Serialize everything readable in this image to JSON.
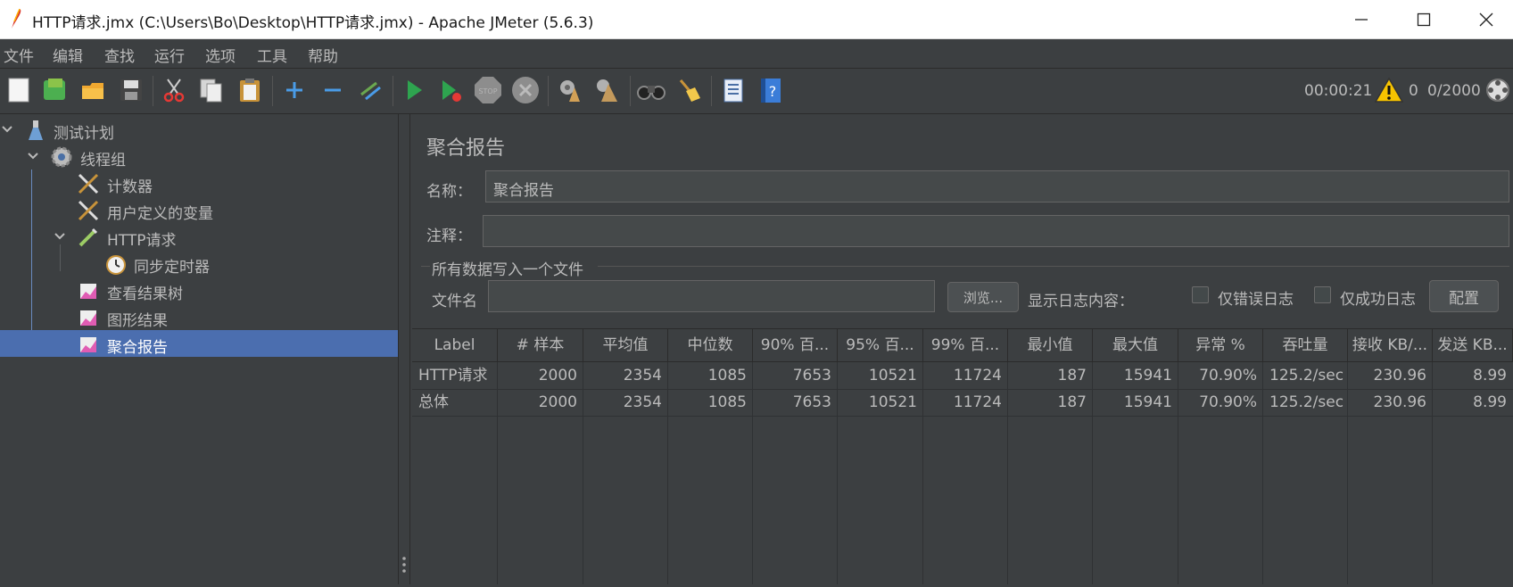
{
  "window": {
    "title": "HTTP请求.jmx (C:\\Users\\Bo\\Desktop\\HTTP请求.jmx) - Apache JMeter (5.6.3)"
  },
  "menu": [
    "文件",
    "编辑",
    "查找",
    "运行",
    "选项",
    "工具",
    "帮助"
  ],
  "toolbar": {
    "icons": [
      "new-icon",
      "templates-icon",
      "open-icon",
      "save-icon",
      "cut-icon",
      "copy-icon",
      "paste-icon",
      "expand-icon",
      "collapse-icon",
      "toggle-icon",
      "start-icon",
      "start-no-pause-icon",
      "stop-icon",
      "shutdown-icon",
      "clear-icon",
      "clear-all-icon",
      "search-icon",
      "reset-search-icon",
      "function-helper-icon",
      "help-icon"
    ],
    "elapsed": "00:00:21",
    "warning_count": "0",
    "threads": "0/2000"
  },
  "tree": {
    "items": [
      {
        "label": "测试计划",
        "icon": "test-plan-icon"
      },
      {
        "label": "线程组",
        "icon": "thread-group-icon"
      },
      {
        "label": "计数器",
        "icon": "config-tools-icon"
      },
      {
        "label": "用户定义的变量",
        "icon": "config-tools-icon"
      },
      {
        "label": "HTTP请求",
        "icon": "sampler-icon"
      },
      {
        "label": "同步定时器",
        "icon": "timer-icon"
      },
      {
        "label": "查看结果树",
        "icon": "listener-icon"
      },
      {
        "label": "图形结果",
        "icon": "listener-icon"
      },
      {
        "label": "聚合报告",
        "icon": "listener-icon"
      }
    ],
    "selected": "聚合报告"
  },
  "panel": {
    "title": "聚合报告",
    "name_label": "名称：",
    "name_value": "聚合报告",
    "comment_label": "注释：",
    "comment_value": "",
    "group_title": "所有数据写入一个文件",
    "file_label": "文件名",
    "file_value": "",
    "browse_label": "浏览...",
    "log_label": "显示日志内容：",
    "errors_only_label": "仅错误日志",
    "success_only_label": "仅成功日志",
    "configure_label": "配置"
  },
  "table": {
    "headers": [
      "Label",
      "# 样本",
      "平均值",
      "中位数",
      "90% 百...",
      "95% 百...",
      "99% 百...",
      "最小值",
      "最大值",
      "异常 %",
      "吞吐量",
      "接收 KB/...",
      "发送 KB..."
    ],
    "rows": [
      [
        "HTTP请求",
        "2000",
        "2354",
        "1085",
        "7653",
        "10521",
        "11724",
        "187",
        "15941",
        "70.90%",
        "125.2/sec",
        "230.96",
        "8.99"
      ],
      [
        "总体",
        "2000",
        "2354",
        "1085",
        "7653",
        "10521",
        "11724",
        "187",
        "15941",
        "70.90%",
        "125.2/sec",
        "230.96",
        "8.99"
      ]
    ]
  },
  "colors": {
    "background": "#3c3f41",
    "selection": "#4b6eaf",
    "text": "#bbbbbb"
  }
}
